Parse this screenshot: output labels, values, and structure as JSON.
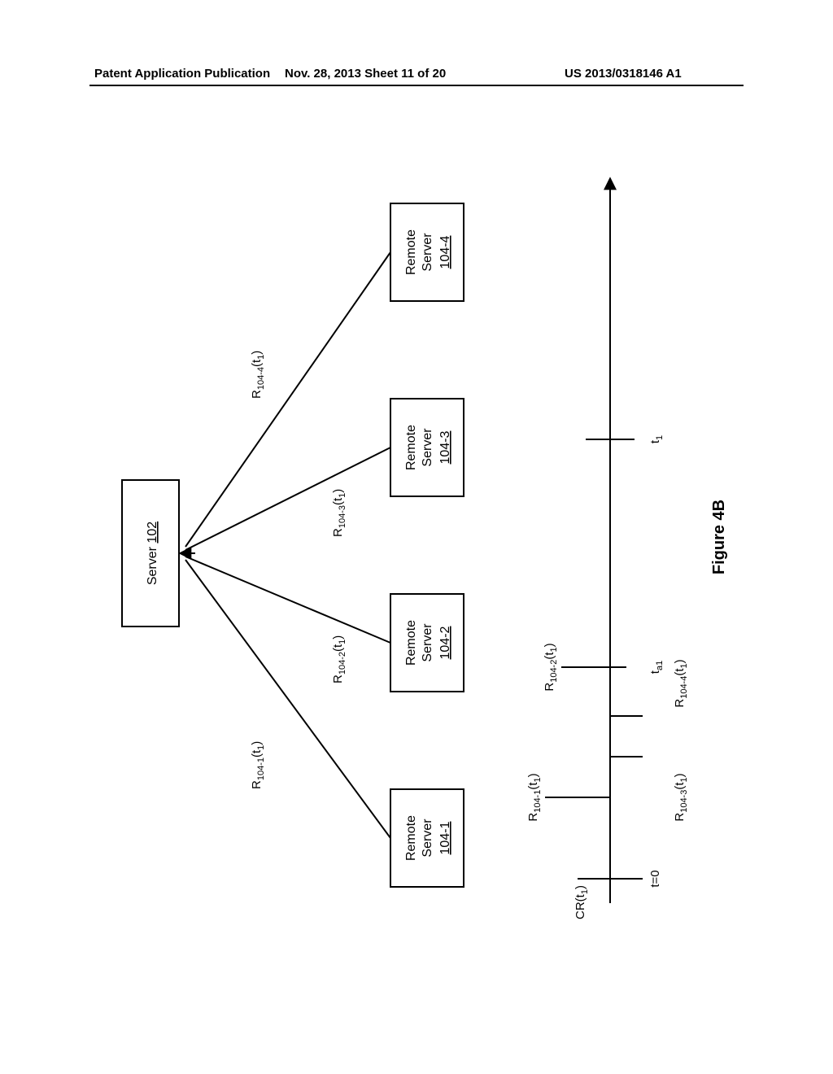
{
  "header": {
    "left": "Patent Application Publication",
    "center": "Nov. 28, 2013  Sheet 11 of 20",
    "right": "US 2013/0318146 A1"
  },
  "diagram": {
    "server_label": "Server",
    "server_ref": "102",
    "rs_label": "Remote Server",
    "rs1": "104-1",
    "rs2": "104-2",
    "rs3": "104-3",
    "rs4": "104-4",
    "edge1_a": "R",
    "edge1_b": "104-1",
    "edge1_c": "(t",
    "edge1_d": "1",
    "edge1_e": ")",
    "edge2_a": "R",
    "edge2_b": "104-2",
    "edge2_c": "(t",
    "edge2_d": "1",
    "edge2_e": ")",
    "edge3_a": "R",
    "edge3_b": "104-3",
    "edge3_c": "(t",
    "edge3_d": "1",
    "edge3_e": ")",
    "edge4_a": "R",
    "edge4_b": "104-4",
    "edge4_c": "(t",
    "edge4_d": "1",
    "edge4_e": ")",
    "tl_cr_a": "CR(t",
    "tl_cr_b": "1",
    "tl_cr_c": ")",
    "tl_r1_a": "R",
    "tl_r1_b": "104-1",
    "tl_r1_c": "(t",
    "tl_r1_d": "1",
    "tl_r1_e": ")",
    "tl_r2_a": "R",
    "tl_r2_b": "104-2",
    "tl_r2_c": "(t",
    "tl_r2_d": "1",
    "tl_r2_e": ")",
    "tl_r3_a": "R",
    "tl_r3_b": "104-3",
    "tl_r3_c": "(t",
    "tl_r3_d": "1",
    "tl_r3_e": ")",
    "tl_r4_a": "R",
    "tl_r4_b": "104-4",
    "tl_r4_c": "(t",
    "tl_r4_d": "1",
    "tl_r4_e": ")",
    "t0": "t=0",
    "ta1_a": "t",
    "ta1_b": "a1",
    "t1_a": "t",
    "t1_b": "1",
    "figure_caption": "Figure 4B"
  }
}
